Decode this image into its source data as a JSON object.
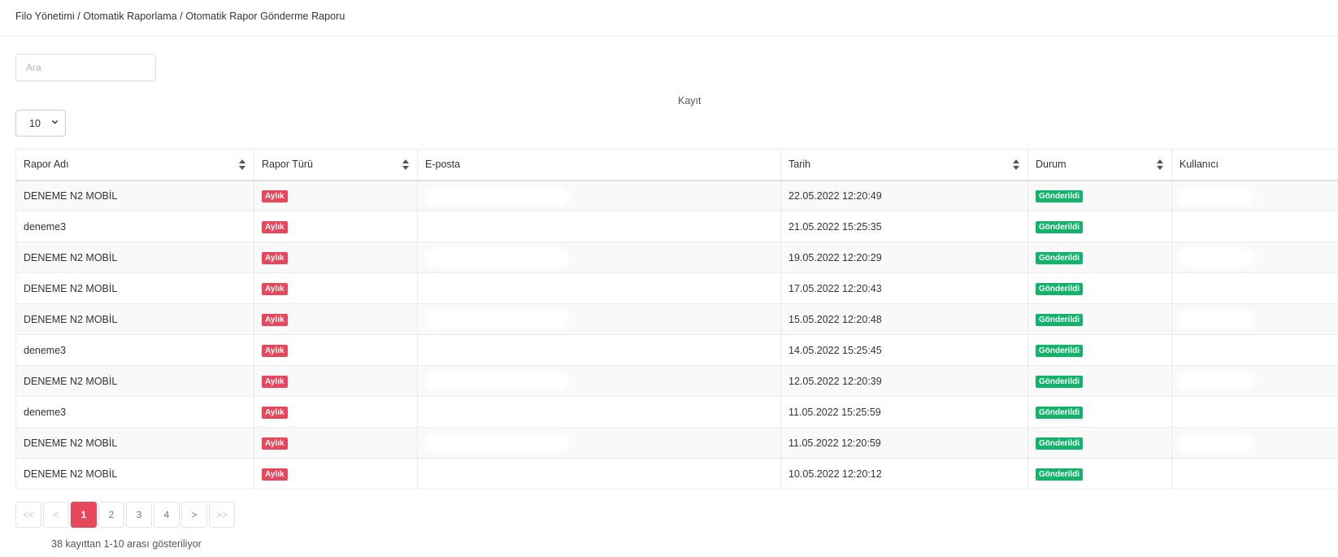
{
  "breadcrumb": "Filo Yönetimi / Otomatik Raporlama / Otomatik Rapor Gönderme Raporu",
  "search": {
    "placeholder": "Ara"
  },
  "page_size": {
    "label": "Kayıt",
    "value": "10"
  },
  "table": {
    "headers": [
      "Rapor Adı",
      "Rapor Türü",
      "E-posta",
      "Tarih",
      "Durum",
      "Kullanıcı"
    ],
    "rows": [
      {
        "name": "DENEME N2 MOBİL",
        "type": "Aylık",
        "email": "",
        "date": "22.05.2022 12:20:49",
        "status": "Gönderildi",
        "user": ""
      },
      {
        "name": "deneme3",
        "type": "Aylık",
        "email": "",
        "date": "21.05.2022 15:25:35",
        "status": "Gönderildi",
        "user": ""
      },
      {
        "name": "DENEME N2 MOBİL",
        "type": "Aylık",
        "email": "",
        "date": "19.05.2022 12:20:29",
        "status": "Gönderildi",
        "user": ""
      },
      {
        "name": "DENEME N2 MOBİL",
        "type": "Aylık",
        "email": "",
        "date": "17.05.2022 12:20:43",
        "status": "Gönderildi",
        "user": ""
      },
      {
        "name": "DENEME N2 MOBİL",
        "type": "Aylık",
        "email": "",
        "date": "15.05.2022 12:20:48",
        "status": "Gönderildi",
        "user": ""
      },
      {
        "name": "deneme3",
        "type": "Aylık",
        "email": "",
        "date": "14.05.2022 15:25:45",
        "status": "Gönderildi",
        "user": ""
      },
      {
        "name": "DENEME N2 MOBİL",
        "type": "Aylık",
        "email": "",
        "date": "12.05.2022 12:20:39",
        "status": "Gönderildi",
        "user": ""
      },
      {
        "name": "deneme3",
        "type": "Aylık",
        "email": "",
        "date": "11.05.2022 15:25:59",
        "status": "Gönderildi",
        "user": ""
      },
      {
        "name": "DENEME N2 MOBİL",
        "type": "Aylık",
        "email": "",
        "date": "11.05.2022 12:20:59",
        "status": "Gönderildi",
        "user": ""
      },
      {
        "name": "DENEME N2 MOBİL",
        "type": "Aylık",
        "email": "",
        "date": "10.05.2022 12:20:12",
        "status": "Gönderildi",
        "user": ""
      }
    ]
  },
  "pagination": {
    "first": "<<",
    "prev": "<",
    "pages": [
      "1",
      "2",
      "3",
      "4"
    ],
    "next": ">",
    "last": ">>",
    "current": "1"
  },
  "info": "38 kayıttan 1-10 arası gösteriliyor",
  "colors": {
    "accent_red": "#e8465a",
    "success_green": "#12b36a"
  }
}
